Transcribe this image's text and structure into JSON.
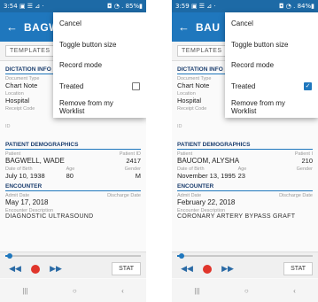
{
  "screens": [
    {
      "status": {
        "time": "3:54",
        "icons": "▣ ☰ ⊿ ·",
        "right": "◘ ◔ . 85%▮"
      },
      "appbar": {
        "back": "←",
        "title": "BAGW"
      },
      "tab": "TEMPLATES",
      "dictation": {
        "section": "DICTATION INFO",
        "doc_type_label": "Document Type",
        "doc_type_value": "Chart Note",
        "location_label": "Location",
        "location_value": "Hospital",
        "receipt_label": "Receipt Code"
      },
      "id_label": "ID",
      "patient": {
        "section": "PATIENT DEMOGRAPHICS",
        "patient_label": "Patient",
        "patient_id_label": "Patient ID",
        "name": "BAGWELL, WADE",
        "patient_id": "2417",
        "dob_label": "Date of Birth",
        "age_label": "Age",
        "gender_label": "Gender",
        "dob": "July 10, 1938",
        "age": "80",
        "gender": "M"
      },
      "encounter": {
        "section": "ENCOUNTER",
        "admit_label": "Admit Date",
        "discharge_label": "Discharge Date",
        "admit": "May 17, 2018",
        "desc_label": "Encounter Description",
        "desc": "DIAGNOSTIC ULTRASOUND"
      },
      "player": {
        "rewind": "◀◀",
        "forward": "▶▶",
        "stat": "STAT",
        "progress": 0.03
      },
      "nav": {
        "recent": "|||",
        "home": "○",
        "back": "‹"
      },
      "menu": {
        "cancel": "Cancel",
        "toggle": "Toggle button size",
        "record": "Record mode",
        "treated": "Treated",
        "treated_checked": false,
        "remove": "Remove from my Worklist"
      }
    },
    {
      "status": {
        "time": "3:59",
        "icons": "▣ ☰ ⊿ ·",
        "right": "◘ ◔ . 84%▮"
      },
      "appbar": {
        "back": "←",
        "title": "BAU"
      },
      "tab": "TEMPLATES",
      "dictation": {
        "section": "DICTATION INFO",
        "doc_type_label": "Document Type",
        "doc_type_value": "Chart Note",
        "location_label": "Location",
        "location_value": "Hospital",
        "receipt_label": "Receipt Code"
      },
      "id_label": "ID",
      "patient": {
        "section": "PATIENT DEMOGRAPHICS",
        "patient_label": "Patient",
        "patient_id_label": "Patient I",
        "name": "BAUCOM, ALYSHA",
        "patient_id": "210",
        "dob_label": "Date of Birth",
        "age_label": "Age",
        "gender_label": "Gender",
        "dob": "November 13, 1995",
        "age": "23",
        "gender": ""
      },
      "encounter": {
        "section": "ENCOUNTER",
        "admit_label": "Admit Date",
        "discharge_label": "Discharge Date",
        "admit": "February 22, 2018",
        "desc_label": "Encounter Description",
        "desc": "CORONARY ARTERY BYPASS GRAFT"
      },
      "player": {
        "rewind": "◀◀",
        "forward": "▶▶",
        "stat": "STAT",
        "progress": 0.03
      },
      "nav": {
        "recent": "|||",
        "home": "○",
        "back": "‹"
      },
      "menu": {
        "cancel": "Cancel",
        "toggle": "Toggle button size",
        "record": "Record mode",
        "treated": "Treated",
        "treated_checked": true,
        "remove": "Remove from my Worklist"
      }
    }
  ]
}
